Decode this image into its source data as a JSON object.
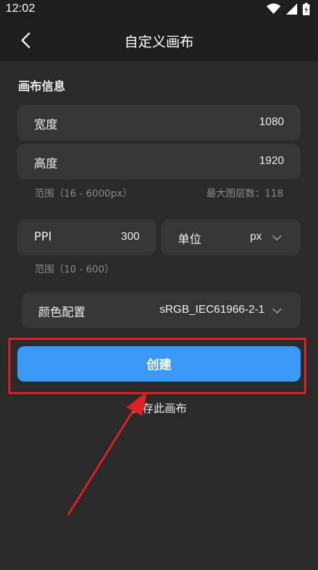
{
  "status_bar": {
    "time": "12:02"
  },
  "header": {
    "title": "自定义画布"
  },
  "section": {
    "title": "画布信息"
  },
  "width_field": {
    "label": "宽度",
    "value": "1080"
  },
  "height_field": {
    "label": "高度",
    "value": "1920"
  },
  "size_hint": {
    "range": "范围（16 - 6000px）",
    "max_layers": "最大图层数：118"
  },
  "ppi_field": {
    "label": "PPI",
    "value": "300"
  },
  "unit_field": {
    "label": "单位",
    "value": "px"
  },
  "ppi_hint": {
    "range": "范围（10 - 600）"
  },
  "color_profile": {
    "label": "颜色配置",
    "value": "sRGB_IEC61966-2-1"
  },
  "create_button": {
    "label": "创建"
  },
  "save_link": {
    "label": "保存此画布"
  },
  "colors": {
    "accent": "#3a98f8",
    "annotation": "#e02020",
    "background": "#2a2a2a",
    "card": "#363636"
  },
  "icons": [
    "back-arrow-icon",
    "wifi-icon",
    "signal-icon",
    "battery-icon",
    "chevron-down-icon"
  ]
}
